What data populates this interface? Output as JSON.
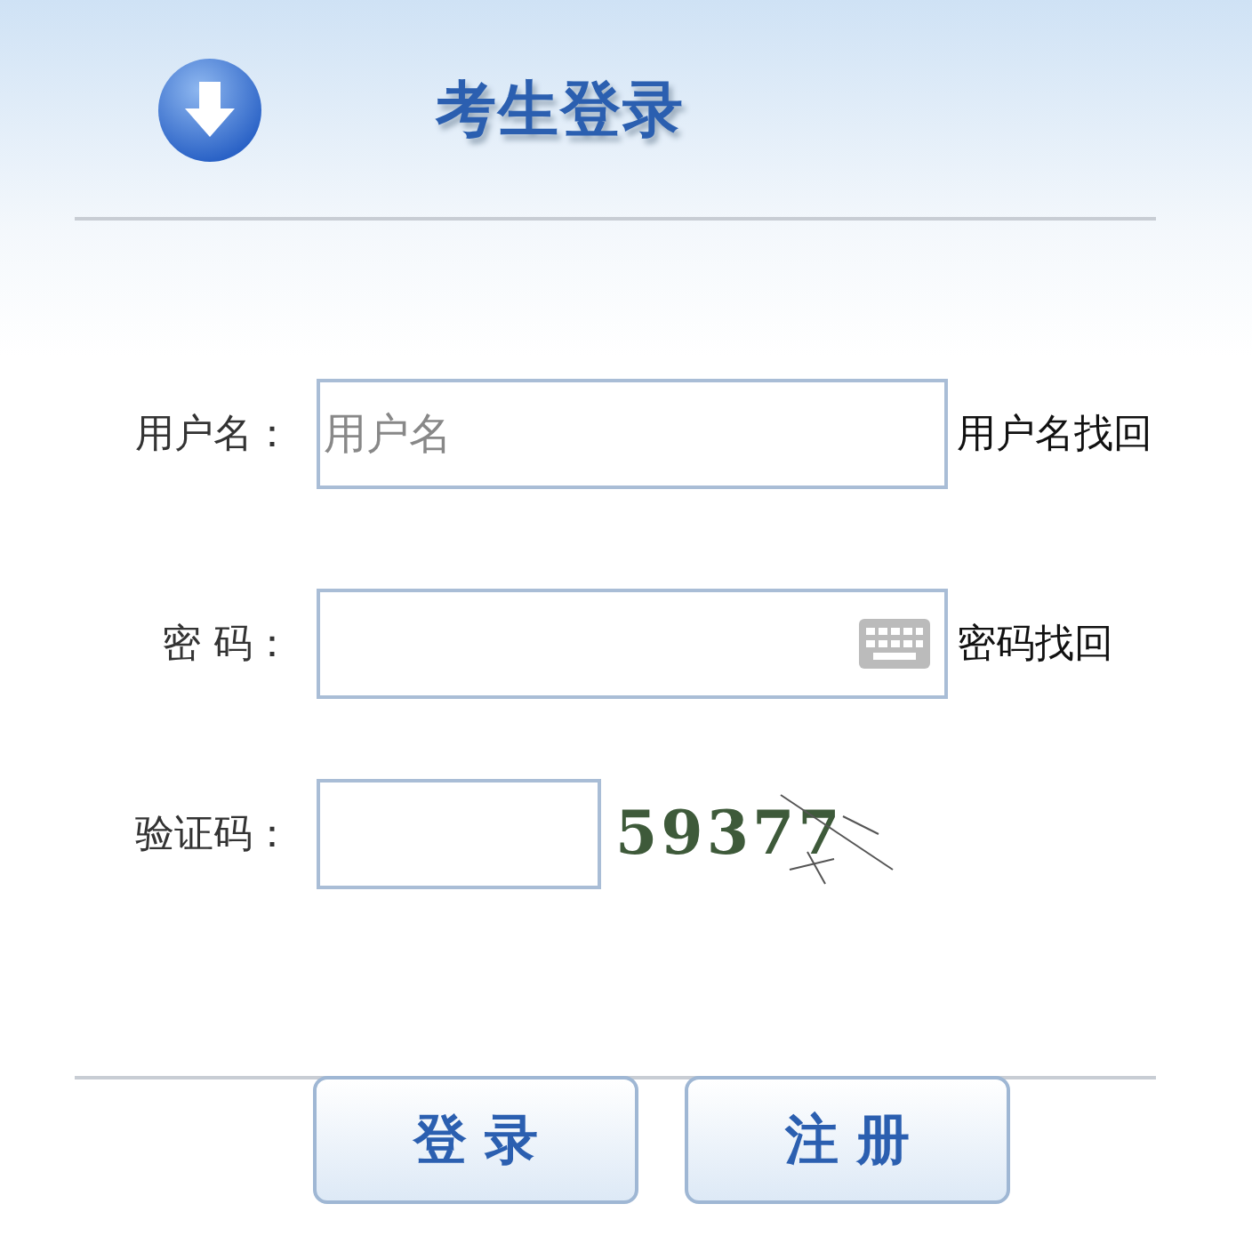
{
  "header": {
    "title": "考生登录"
  },
  "fields": [
    {
      "kind": "text",
      "label": "用户名：",
      "placeholder": "用户名",
      "link": "用户名找回"
    },
    {
      "kind": "password",
      "label": "密 码：",
      "link": "密码找回"
    },
    {
      "kind": "captcha",
      "label": "验证码：",
      "captcha": "59377"
    }
  ],
  "buttons": [
    "登 录",
    "注 册"
  ]
}
